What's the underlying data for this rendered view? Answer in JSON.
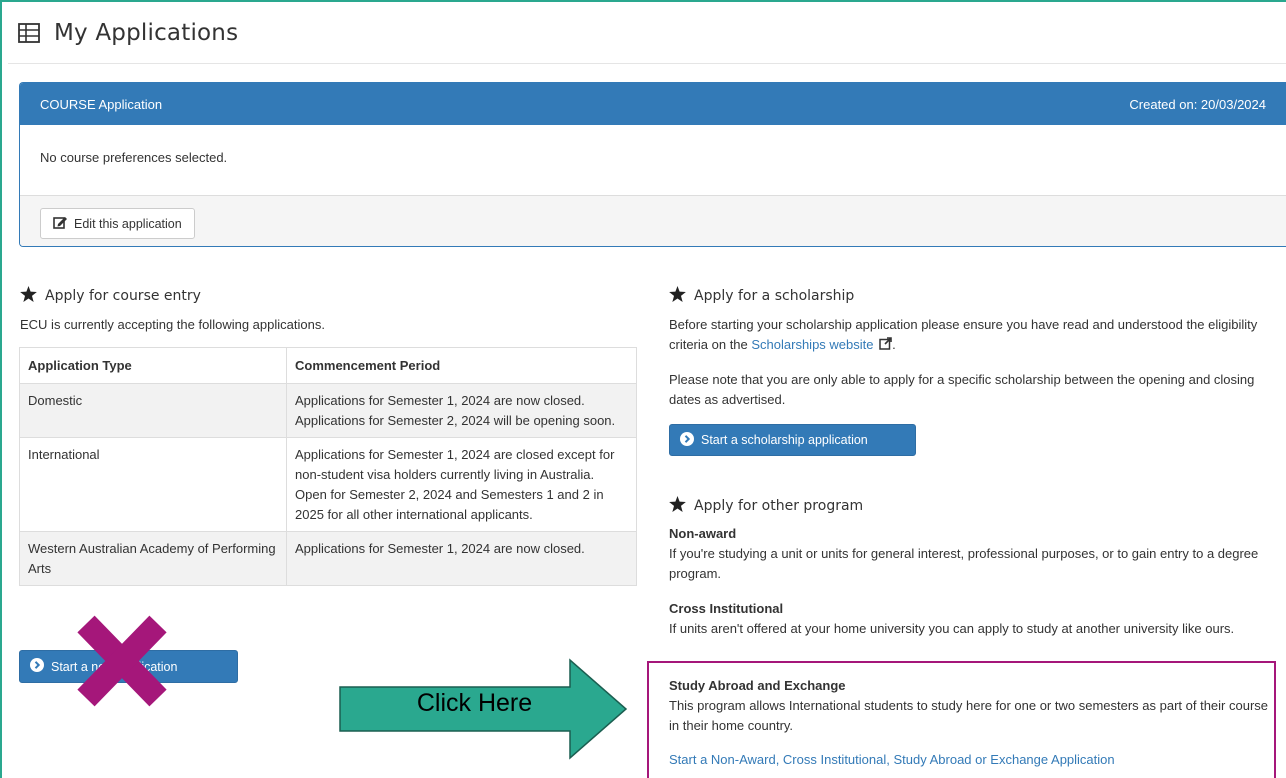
{
  "page": {
    "title": "My Applications",
    "accent_color": "#337ab7",
    "highlight_color": "#a5177a",
    "arrow_color": "#2aa88f"
  },
  "course_panel": {
    "heading": "COURSE Application",
    "created": "Created on: 20/03/2024",
    "body_text": "No course preferences selected.",
    "edit_button": "Edit this application"
  },
  "course_entry": {
    "heading": "Apply for course entry",
    "intro": "ECU is currently accepting the following applications.",
    "table": {
      "headers": [
        "Application Type",
        "Commencement Period"
      ],
      "rows": [
        [
          "Domestic",
          "Applications for Semester 1, 2024 are now closed. Applications for Semester 2, 2024 will be opening soon."
        ],
        [
          "International",
          "Applications for Semester 1, 2024 are closed except for non-student visa holders currently living in Australia. Open for Semester 2, 2024 and Semesters 1 and 2 in 2025 for all other international applicants."
        ],
        [
          "Western Australian Academy of Performing Arts",
          "Applications for Semester 1, 2024 are now closed."
        ]
      ]
    },
    "start_button": "Start a new application"
  },
  "scholarship": {
    "heading": "Apply for a scholarship",
    "para1_before": "Before starting your scholarship application please ensure you have read and understood the eligibility criteria on the ",
    "para1_link": "Scholarships website",
    "para1_after": ".",
    "para2": "Please note that you are only able to apply for a specific scholarship between the opening and closing dates as advertised.",
    "start_button": "Start a scholarship application"
  },
  "other_program": {
    "heading": "Apply for other program",
    "non_award_title": "Non-award",
    "non_award_text": "If you're studying a unit or units for general interest, professional purposes, or to gain entry to a degree program.",
    "cross_title": "Cross Institutional",
    "cross_text": "If units aren't offered at your home university you can apply to study at another university like ours.",
    "study_abroad_title": "Study Abroad and Exchange",
    "study_abroad_text": "This program allows International students to study here for one or two semesters as part of their course in their home country.",
    "start_link": "Start a Non-Award, Cross Institutional, Study Abroad or Exchange Application"
  },
  "annotations": {
    "arrow_label": "Click Here"
  }
}
